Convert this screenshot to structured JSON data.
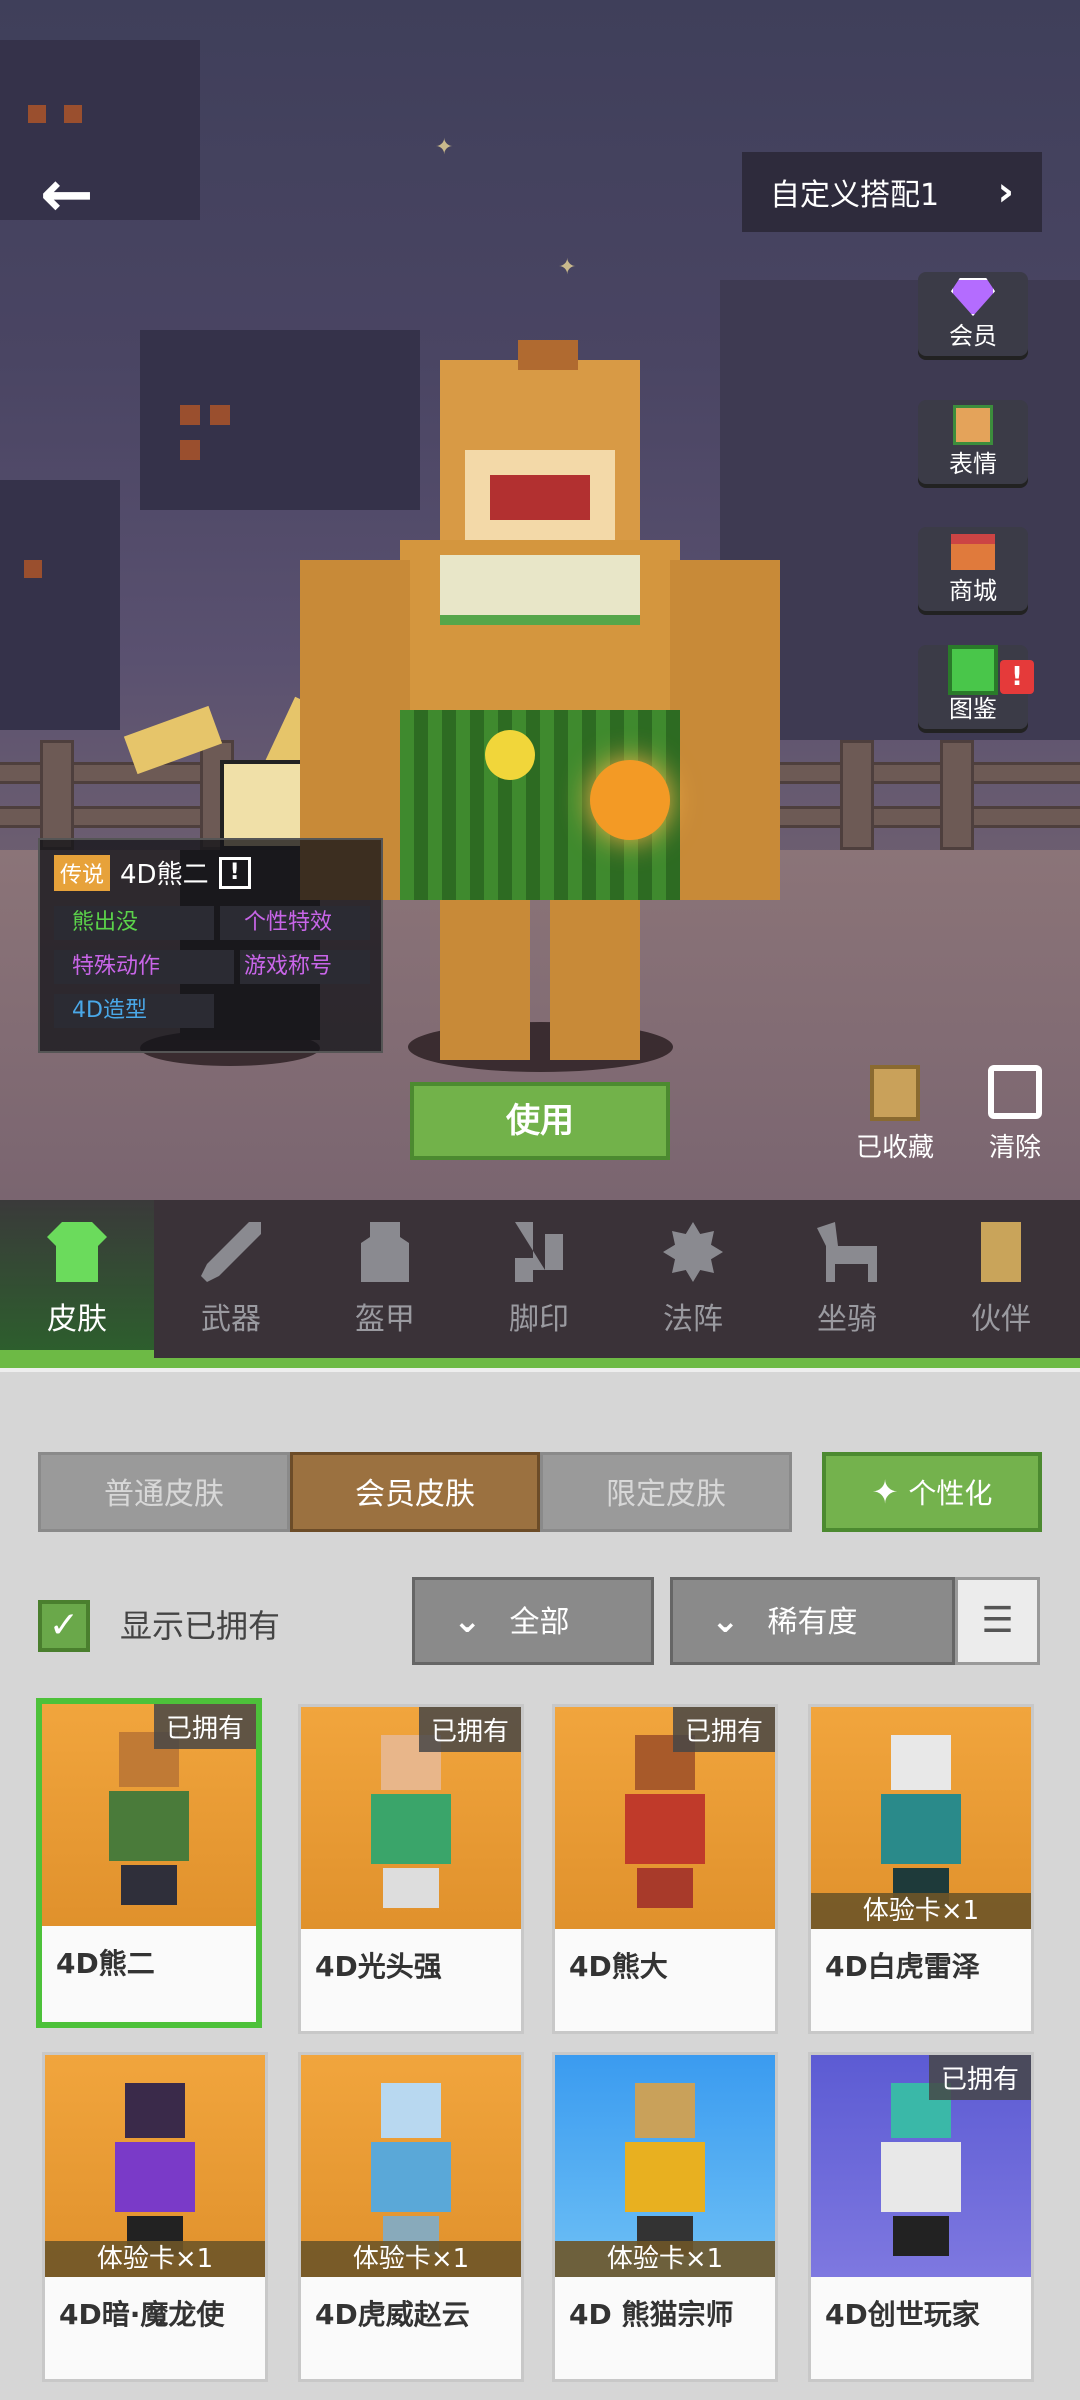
{
  "header": {
    "outfit_label": "自定义搭配1",
    "back_icon": "arrow-left-icon",
    "next_icon": "chevron-right-icon"
  },
  "side_menu": [
    {
      "label": "会员",
      "icon": "gem-icon"
    },
    {
      "label": "表情",
      "icon": "emote-icon"
    },
    {
      "label": "商城",
      "icon": "shop-icon"
    },
    {
      "label": "图鉴",
      "icon": "book-icon",
      "alert": "!"
    }
  ],
  "info_card": {
    "rarity": "传说",
    "skin_name": "4D熊二",
    "info_icon": "!",
    "features": [
      "熊出没",
      "个性特效",
      "特殊动作",
      "游戏称号",
      "4D造型"
    ]
  },
  "actions": {
    "use": "使用",
    "collect": "已收藏",
    "clear": "清除"
  },
  "tabs": [
    "皮肤",
    "武器",
    "盔甲",
    "脚印",
    "法阵",
    "坐骑",
    "伙伴"
  ],
  "filters": {
    "segments": [
      "普通皮肤",
      "会员皮肤",
      "限定皮肤"
    ],
    "personalize": "个性化",
    "show_owned": "显示已拥有",
    "show_owned_checked": true,
    "category": "全部",
    "sort": "稀有度"
  },
  "skins": [
    {
      "name": "4D熊二",
      "badge": "已拥有",
      "trial": ""
    },
    {
      "name": "4D光头强",
      "badge": "已拥有",
      "trial": ""
    },
    {
      "name": "4D熊大",
      "badge": "已拥有",
      "trial": ""
    },
    {
      "name": "4D白虎雷泽",
      "badge": "",
      "trial": "体验卡×1"
    },
    {
      "name": "4D暗·魔龙使",
      "badge": "",
      "trial": "体验卡×1"
    },
    {
      "name": "4D虎威赵云",
      "badge": "",
      "trial": "体验卡×1"
    },
    {
      "name": "4D 熊猫宗师",
      "badge": "",
      "trial": "体验卡×1"
    },
    {
      "name": "4D创世玩家",
      "badge": "已拥有",
      "trial": ""
    }
  ],
  "colors": {
    "accent_green": "#72b24a",
    "active_segment": "#9b7140",
    "rarity_gold": "#e7a23a"
  }
}
